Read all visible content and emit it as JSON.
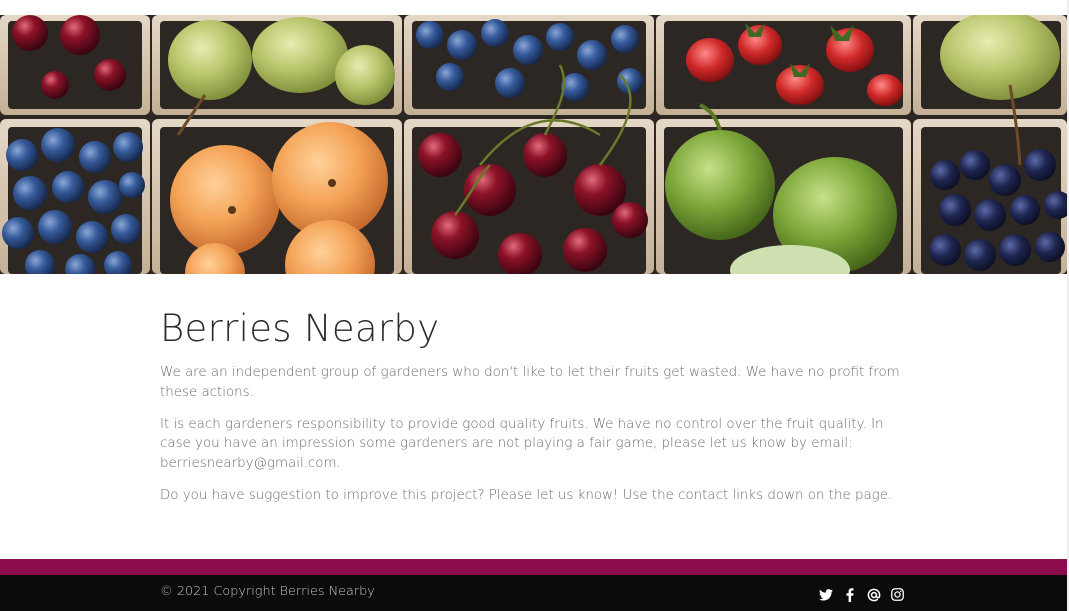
{
  "hero": {
    "image_alt": "fruit crates with cherries, pears, blueberries, apricots, figs and strawberries"
  },
  "main": {
    "title": "Berries Nearby",
    "paragraphs": [
      "We are an independent group of gardeners who don't like to let their fruits get wasted. We have no profit from these actions.",
      "It is each gardeners responsibility to provide good quality fruits. We have no control over the fruit quality. In case you have an impression some gardeners are not playing a fair game, please let us know by email: berriesnearby@gmail.com.",
      "Do you have suggestion to improve this project? Please let us know! Use the contact links down on the page."
    ]
  },
  "footer": {
    "copyright": "© 2021 Copyright Berries Nearby",
    "social_icons": [
      "twitter-icon",
      "facebook-icon",
      "email-at-icon",
      "instagram-icon"
    ]
  },
  "colors": {
    "accent_strip": "#8c0b4d",
    "footer_bg": "#0b0b0b",
    "title": "#2b2b2b",
    "body_text": "#6b6b6b"
  }
}
